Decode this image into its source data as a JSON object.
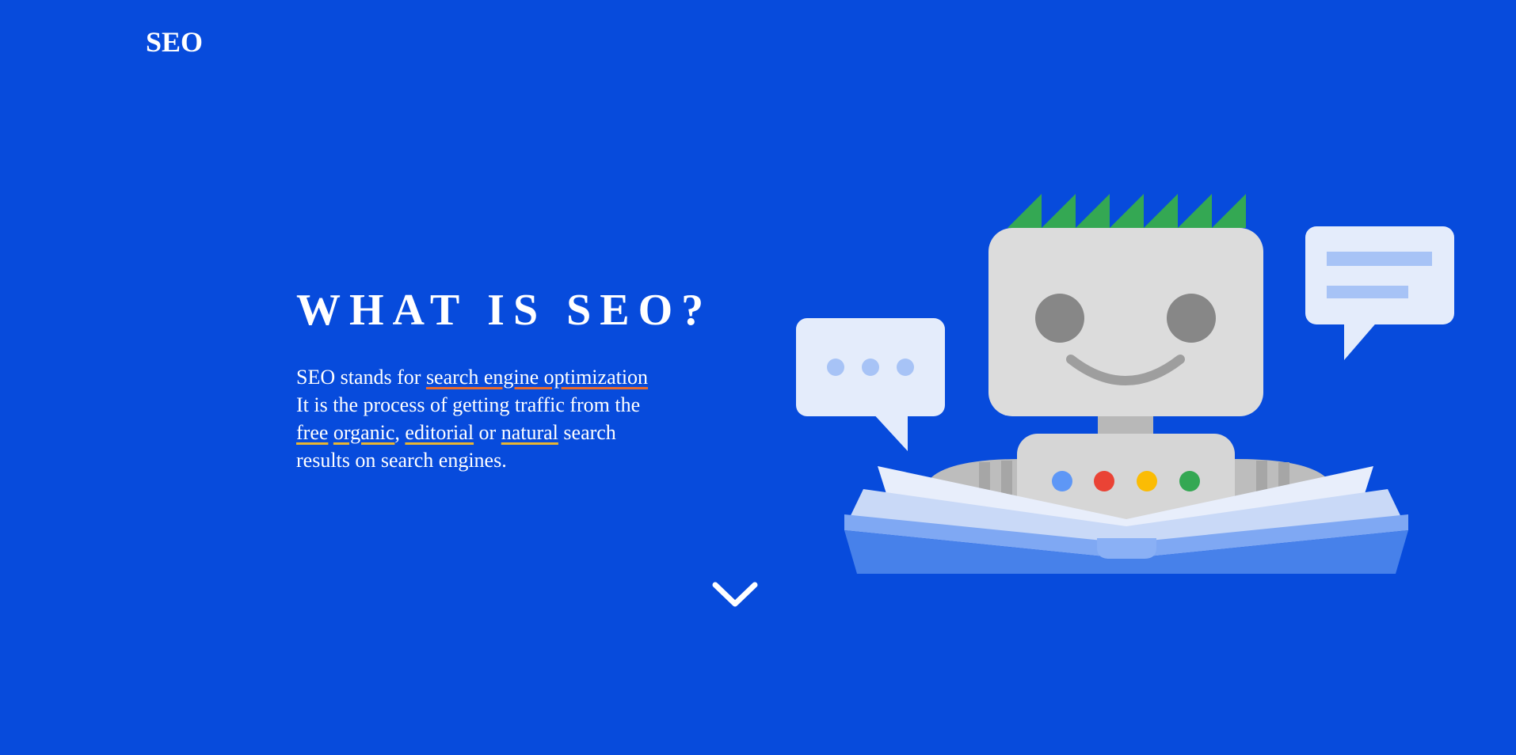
{
  "header": {
    "logo": "SEO"
  },
  "hero": {
    "title": "WHAT IS SEO?",
    "paragraph": {
      "line1_prefix": "SEO stands for ",
      "line1_link": "search engine optimization",
      "line2": "It is the process of getting traffic from the",
      "line3_word1": "free",
      "line3_word2": "organic",
      "line3_comma": ",",
      "line3_word3": "editorial",
      "line3_or": " or ",
      "line3_word4": "natural",
      "line3_suffix": " search",
      "line4": "results on search engines."
    }
  },
  "scroll_down": {
    "icon": "chevron-down-icon"
  },
  "illustration": {
    "subject": "robot-reading-book",
    "button_colors": [
      "#5e97f6",
      "#ea4335",
      "#fbbc04",
      "#34a853"
    ]
  },
  "colors": {
    "background": "#074bdc",
    "underline_orange": "#ea6b2c",
    "underline_yellow": "#e9b531"
  }
}
